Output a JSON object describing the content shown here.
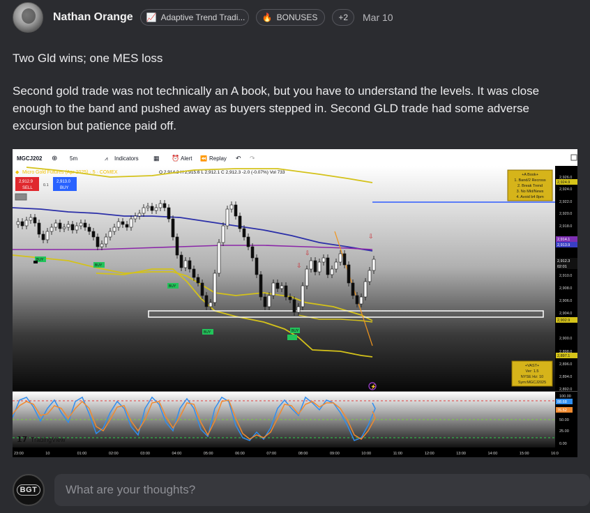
{
  "author": {
    "name": "Nathan Orange"
  },
  "tags": {
    "course": "Adaptive Trend Tradi...",
    "bonuses": "BONUSES",
    "more": "+2"
  },
  "date": "Mar 10",
  "post": {
    "title": "Two Gld wins; one MES loss",
    "body": "Second gold trade was not technically an A book, but you have to understand the levels.  It was close enough to the band and pushed away as buyers stepped in.    Second GLD trade had some adverse excursion but patience paid off."
  },
  "chart": {
    "toolbar": {
      "symbol": "MGCJ202",
      "interval": "5m",
      "indicators": "Indicators",
      "alert": "Alert",
      "replay": "Replay"
    },
    "instrument": "Micro Gold Futures (Apr 2025) · 5 · COMEX",
    "ohlc": "O 2,914.3  H 2,915.6  L 2,912.1  C 2,912.3  -2.0 (-0.07%)  Vol 733",
    "sell_price": "2,912.9",
    "sell_label": "SELL",
    "buy_price": "2,913.0",
    "buy_label": "BUY",
    "spread": "0.1",
    "a_book": [
      "+A Book+",
      "1. Band/2 Recross",
      "2. Break Trend",
      "3. No Mkt/News",
      "4. Avoid b4 8pm"
    ],
    "vast": [
      "+VAST+",
      "Ver: 1.5",
      "NYSE Hz: 10",
      "Sym:MGCJ2025"
    ],
    "signal_buy": "BUY",
    "signal_sell": "S",
    "price_axis": [
      "2,926.0",
      "2,924.0",
      "2,922.0",
      "2,920.0",
      "2,918.0",
      "2,916.0",
      "2,912.0",
      "2,910.0",
      "2,908.0",
      "2,906.0",
      "2,904.0",
      "2,900.0",
      "2,898.0",
      "2,896.0",
      "2,894.0",
      "2,892.0"
    ],
    "price_tags": [
      {
        "label": "2,924.9",
        "color": "#d6c41a"
      },
      {
        "label": "2,914.1",
        "color": "#7d2fb3"
      },
      {
        "label": "2,913.9",
        "color": "#3a3fc4"
      },
      {
        "label": "2,912.3",
        "color": "#111111"
      },
      {
        "label": "02:01",
        "color": "#111111"
      },
      {
        "label": "2,902.9",
        "color": "#d6c41a"
      },
      {
        "label": "2,897.1",
        "color": "#d6c41a"
      }
    ],
    "osc_axis": [
      "100.00",
      "75.00",
      "50.00",
      "25.00",
      "0.00"
    ],
    "osc_tags": [
      {
        "label": "88.68",
        "color": "#2f8ef0"
      },
      {
        "label": "76.52",
        "color": "#f08a2f"
      }
    ],
    "time_axis": [
      "23:00",
      "10",
      "01:00",
      "02:00",
      "03:00",
      "04:00",
      "05:00",
      "06:00",
      "07:00",
      "08:00",
      "09:00",
      "10:00",
      "11:00",
      "12:00",
      "13:00",
      "14:00",
      "15:00",
      "16:0"
    ],
    "watermark": "TradingView"
  },
  "composer": {
    "logo": "BGT",
    "placeholder": "What are your thoughts?"
  }
}
